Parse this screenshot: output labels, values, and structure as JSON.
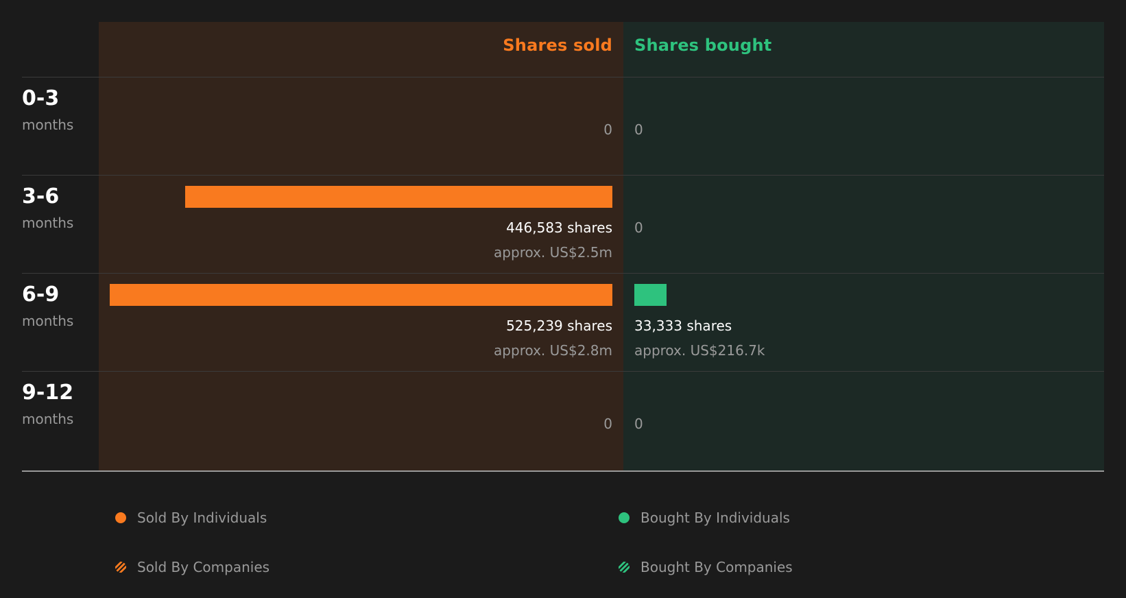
{
  "colors": {
    "sold": "#f97a1f",
    "bought": "#2ec27e",
    "sold_bg": "#33241b",
    "bought_bg": "#1c2925"
  },
  "chart_data": {
    "type": "bar",
    "orientation": "horizontal-diverging",
    "headers": {
      "sold": "Shares sold",
      "bought": "Shares bought"
    },
    "periods": [
      {
        "range": "0-3",
        "unit": "months",
        "sold": 0,
        "bought": 0,
        "sold_label": "0",
        "bought_label": "0",
        "sold_approx": "",
        "bought_approx": ""
      },
      {
        "range": "3-6",
        "unit": "months",
        "sold": 446583,
        "bought": 0,
        "sold_label": "446,583 shares",
        "bought_label": "0",
        "sold_approx": "approx. US$2.5m",
        "bought_approx": ""
      },
      {
        "range": "6-9",
        "unit": "months",
        "sold": 525239,
        "bought": 33333,
        "sold_label": "525,239 shares",
        "bought_label": "33,333 shares",
        "sold_approx": "approx. US$2.8m",
        "bought_approx": "approx. US$216.7k"
      },
      {
        "range": "9-12",
        "unit": "months",
        "sold": 0,
        "bought": 0,
        "sold_label": "0",
        "bought_label": "0",
        "sold_approx": "",
        "bought_approx": ""
      }
    ],
    "legend": [
      {
        "label": "Sold By Individuals",
        "color": "#f97a1f",
        "style": "solid"
      },
      {
        "label": "Bought By Individuals",
        "color": "#2ec27e",
        "style": "solid"
      },
      {
        "label": "Sold By Companies",
        "color": "#f97a1f",
        "style": "hatched"
      },
      {
        "label": "Bought By Companies",
        "color": "#2ec27e",
        "style": "hatched"
      }
    ]
  }
}
